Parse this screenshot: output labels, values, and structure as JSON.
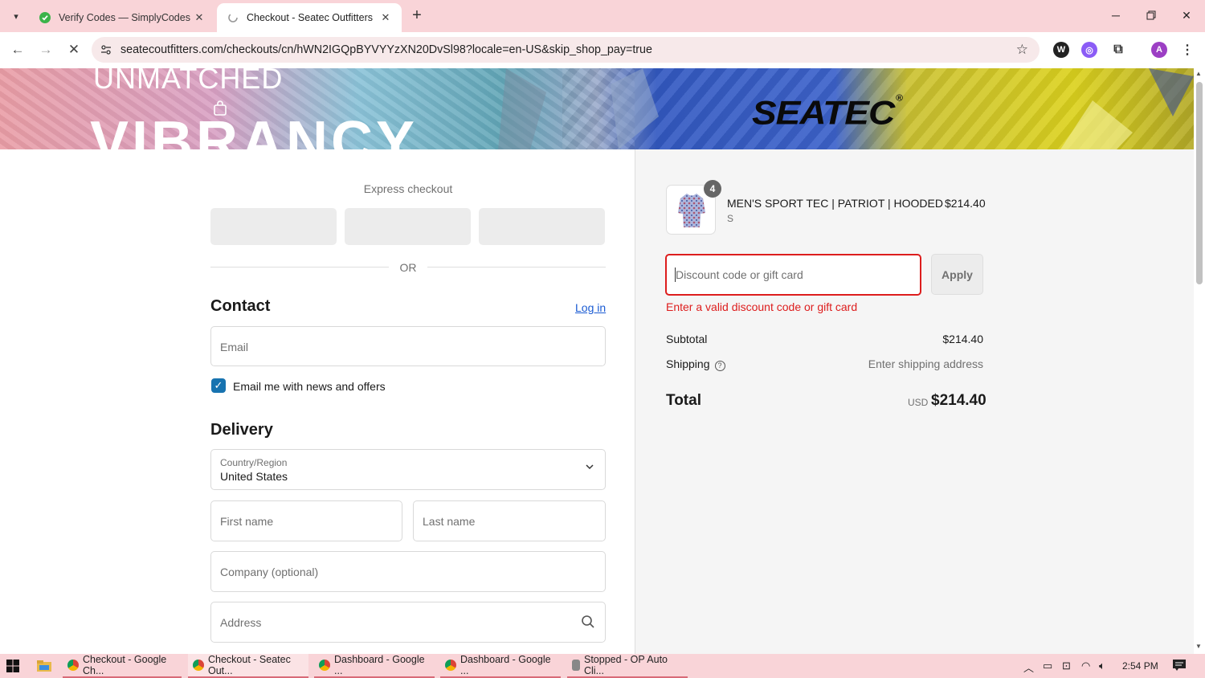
{
  "browser": {
    "tabs": [
      {
        "title": "Verify Codes — SimplyCodes",
        "active": false
      },
      {
        "title": "Checkout - Seatec Outfitters",
        "active": true
      }
    ],
    "url": "seatecoutfitters.com/checkouts/cn/hWN2IGQpBYVYYzXN20DvSl98?locale=en-US&skip_shop_pay=true",
    "profile_initial": "A"
  },
  "banner": {
    "headline_top": "UNMATCHED",
    "headline_bottom": "VIBRANCY",
    "logo": "SEATEC",
    "logo_mark": "®"
  },
  "checkout": {
    "express_label": "Express checkout",
    "or_label": "OR",
    "contact_title": "Contact",
    "login_label": "Log in",
    "email_placeholder": "Email",
    "news_label": "Email me with news and offers",
    "news_checked": true,
    "delivery_title": "Delivery",
    "country_label": "Country/Region",
    "country_value": "United States",
    "first_name_placeholder": "First name",
    "last_name_placeholder": "Last name",
    "company_placeholder": "Company (optional)",
    "address_placeholder": "Address"
  },
  "summary": {
    "product_name": "MEN'S SPORT TEC | PATRIOT | HOODED",
    "product_variant": "S",
    "product_qty": "4",
    "product_price": "$214.40",
    "discount_placeholder": "Discount code or gift card",
    "apply_label": "Apply",
    "error": "Enter a valid discount code or gift card",
    "subtotal_label": "Subtotal",
    "subtotal_value": "$214.40",
    "shipping_label": "Shipping",
    "shipping_value": "Enter shipping address",
    "total_label": "Total",
    "total_currency": "USD",
    "total_value": "$214.40"
  },
  "taskbar": {
    "items": [
      "Checkout - Google Ch...",
      "Checkout - Seatec Out...",
      "Dashboard - Google ...",
      "Dashboard - Google ...",
      "Stopped - OP Auto Cli..."
    ],
    "time": "2:54 PM"
  },
  "colors": {
    "accent": "#1773b0",
    "error": "#dd1d1d",
    "chrome": "#f9d4d8"
  }
}
